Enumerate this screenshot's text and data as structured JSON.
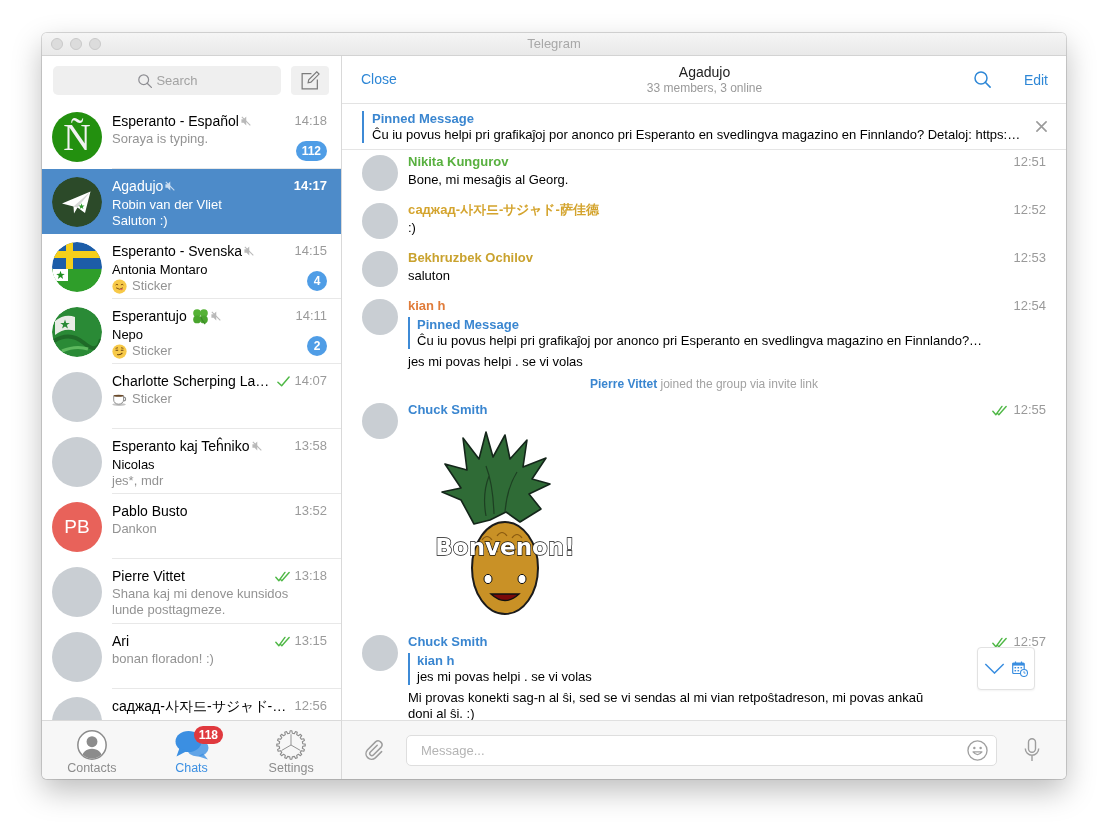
{
  "window": {
    "title": "Telegram"
  },
  "sidebar": {
    "search": {
      "placeholder": "Search"
    },
    "chats": [
      {
        "name": "Esperanto - Español",
        "muted": true,
        "time": "14:18",
        "avatar": {
          "kind": "letter",
          "text": "Ñ"
        },
        "preview": "Soraya is typing.",
        "unread": "112",
        "selected": false
      },
      {
        "name": "Agadujo",
        "muted": true,
        "time": "14:17",
        "avatar": {
          "kind": "plane"
        },
        "sender": "Robin van der Vliet",
        "preview": "Saluton :)",
        "selected": true
      },
      {
        "name": "Esperanto - Svenska",
        "muted": true,
        "time": "14:15",
        "avatar": {
          "kind": "flag-se"
        },
        "sender": "Antonia Montaro",
        "preview_emoji": {
          "kind": "yum"
        },
        "preview": "Sticker",
        "unread": "4",
        "selected": false
      },
      {
        "name": "Esperantujo",
        "name_emoji": {
          "kind": "clover"
        },
        "muted": true,
        "time": "14:11",
        "avatar": {
          "kind": "flag-eo"
        },
        "sender": "Nepo",
        "preview_emoji": {
          "kind": "smirk"
        },
        "preview": "Sticker",
        "unread": "2",
        "selected": false
      },
      {
        "name": "Charlotte Scherping La…",
        "muted": false,
        "sent": true,
        "read": false,
        "time": "14:07",
        "avatar": {
          "kind": "photo"
        },
        "preview_emoji": {
          "kind": "cup"
        },
        "preview": "Sticker",
        "selected": false
      },
      {
        "name": "Esperanto kaj Teĥniko",
        "muted": true,
        "time": "13:58",
        "avatar": {
          "kind": "photo"
        },
        "sender": "Nicolas",
        "preview": "jes*, mdr",
        "selected": false
      },
      {
        "name": "Pablo Busto",
        "muted": false,
        "time": "13:52",
        "avatar": {
          "kind": "initials",
          "text": "PB"
        },
        "preview": "Dankon",
        "selected": false
      },
      {
        "name": "Pierre Vittet",
        "muted": false,
        "sent": true,
        "read": true,
        "time": "13:18",
        "avatar": {
          "kind": "photo"
        },
        "preview": "Shana kaj mi denove kunsidos lunde posttagmeze.",
        "selected": false
      },
      {
        "name": "Ari",
        "muted": false,
        "sent": true,
        "read": true,
        "time": "13:15",
        "avatar": {
          "kind": "photo"
        },
        "preview": "bonan floradon! :)",
        "selected": false
      },
      {
        "name": "саджад-사자드-サジャド-…",
        "muted": false,
        "time": "12:56",
        "avatar": {
          "kind": "photo"
        },
        "selected": false
      }
    ]
  },
  "tabs": [
    {
      "label": "Contacts",
      "kind": "contacts",
      "selected": false
    },
    {
      "label": "Chats",
      "kind": "chats",
      "selected": true,
      "badge": "118"
    },
    {
      "label": "Settings",
      "kind": "settings",
      "selected": false
    }
  ],
  "chat": {
    "header": {
      "close": "Close",
      "title": "Agadujo",
      "subtitle": "33 members, 3 online",
      "edit": "Edit"
    },
    "pinned": {
      "label": "Pinned Message",
      "text": "Ĉu iu povus helpi pri grafikaĵoj por anonco pri Esperanto en svedlingva magazino en Finnlando? Detaloj: https:…"
    },
    "messages": [
      {
        "kind": "text",
        "author": "Nikita Kungurov",
        "color": "#58b03f",
        "time": "12:51",
        "text": "Bone, mi mesaĝis al Georg."
      },
      {
        "kind": "text",
        "author": "саджад-사자드-サジャド-萨佳德",
        "color": "#d4a42e",
        "time": "12:52",
        "text": ":)"
      },
      {
        "kind": "text",
        "author": "Bekhruzbek Ochilov",
        "color": "#c9a22e",
        "time": "12:53",
        "text": "saluton"
      },
      {
        "kind": "text",
        "author": "kian h",
        "color": "#e07c3a",
        "time": "12:54",
        "reply": {
          "title": "Pinned Message",
          "text": "Ĉu iu povus helpi pri grafikaĵoj por anonco pri Esperanto en svedlingva magazino en Finnlando?…"
        },
        "text": "jes mi povas helpi . se vi volas"
      },
      {
        "kind": "service",
        "actor": "Pierre Vittet",
        "text": "joined the group via invite link"
      },
      {
        "kind": "sticker",
        "author": "Chuck Smith",
        "color": "#3a86d0",
        "time": "12:55",
        "sent": true,
        "read": true,
        "caption": "Bonvenon!"
      },
      {
        "kind": "text",
        "author": "Chuck Smith",
        "color": "#3a86d0",
        "time": "12:57",
        "sent": true,
        "read": true,
        "reply": {
          "title": "kian h",
          "text": "jes mi povas helpi . se vi volas"
        },
        "text": "Mi provas konekti sag-n al ŝi, sed se vi sendas al mi vian retpoŝtadreson, mi povas ankaŭ doni al ŝi. :)"
      }
    ],
    "composer": {
      "placeholder": "Message..."
    }
  }
}
